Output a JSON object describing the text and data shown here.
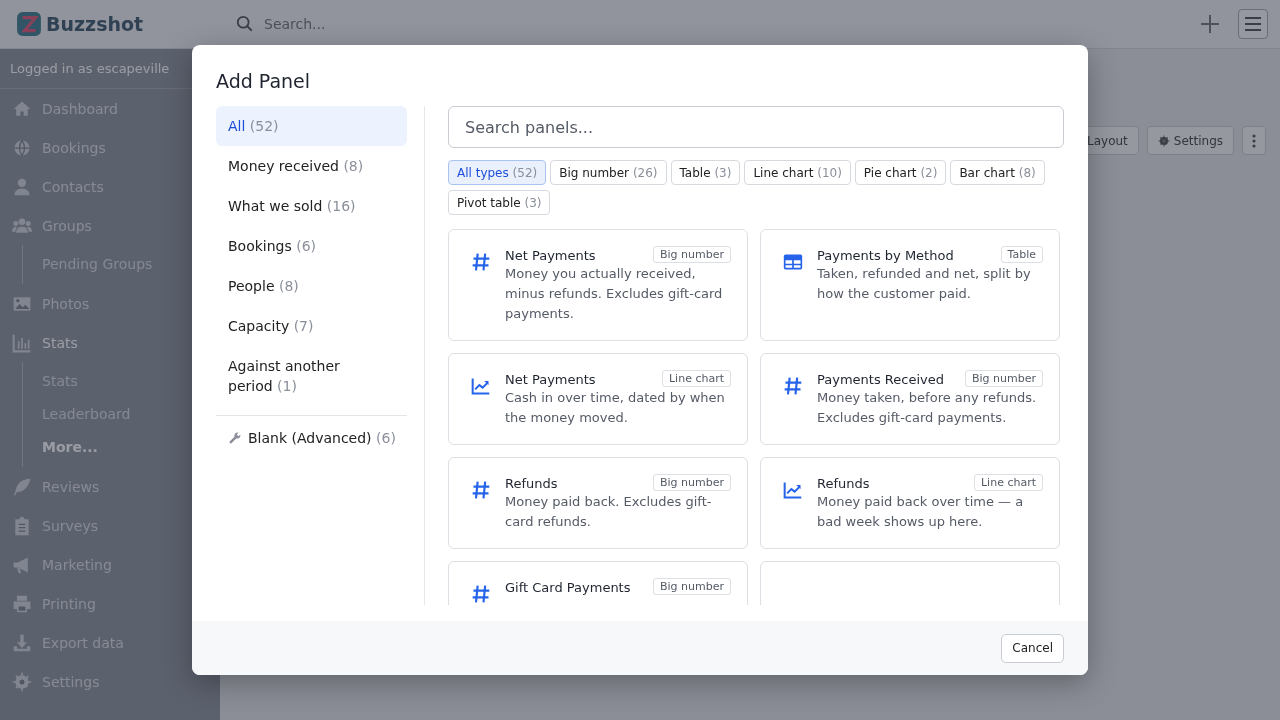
{
  "app": {
    "logo": "Buzzshot",
    "search": {
      "placeholder": "Search..."
    },
    "user": "Logged in as escapeville",
    "nav": [
      {
        "label": "Dashboard",
        "selected": false
      },
      {
        "label": "Bookings",
        "selected": false
      },
      {
        "label": "Contacts",
        "selected": false
      },
      {
        "label": "Groups",
        "selected": false,
        "children": [
          {
            "label": "Pending Groups",
            "selected": false
          }
        ]
      },
      {
        "label": "Photos",
        "selected": false
      },
      {
        "label": "Stats",
        "selected": true,
        "children": [
          {
            "label": "Stats",
            "selected": false
          },
          {
            "label": "Leaderboard",
            "selected": false
          },
          {
            "label": "More...",
            "selected": true
          }
        ]
      },
      {
        "label": "Reviews",
        "selected": false
      },
      {
        "label": "Surveys",
        "selected": false
      },
      {
        "label": "Marketing",
        "selected": false
      },
      {
        "label": "Printing",
        "selected": false
      },
      {
        "label": "Export data",
        "selected": false
      },
      {
        "label": "Settings",
        "selected": false
      }
    ],
    "toolbar": [
      "Layout",
      "Settings"
    ]
  },
  "dialog": {
    "title": "Add Panel",
    "categories": [
      {
        "label": "All",
        "count": "(52)",
        "selected": true
      },
      {
        "label": "Money received",
        "count": "(8)",
        "selected": false
      },
      {
        "label": "What we sold",
        "count": "(16)",
        "selected": false
      },
      {
        "label": "Bookings",
        "count": "(6)",
        "selected": false
      },
      {
        "label": "People",
        "count": "(8)",
        "selected": false
      },
      {
        "label": "Capacity",
        "count": "(7)",
        "selected": false
      },
      {
        "label": "Against another period",
        "count": "(1)",
        "selected": false
      }
    ],
    "advanced": {
      "label": "Blank (Advanced)",
      "count": "(6)",
      "selected": false
    },
    "search": {
      "placeholder": "Search panels..."
    },
    "types": [
      {
        "label": "All types",
        "count": "(52)",
        "selected": true
      },
      {
        "label": "Big number",
        "count": "(26)",
        "selected": false
      },
      {
        "label": "Table",
        "count": "(3)",
        "selected": false
      },
      {
        "label": "Line chart",
        "count": "(10)",
        "selected": false
      },
      {
        "label": "Pie chart",
        "count": "(2)",
        "selected": false
      },
      {
        "label": "Bar chart",
        "count": "(8)",
        "selected": false
      },
      {
        "label": "Pivot table",
        "count": "(3)",
        "selected": false
      }
    ],
    "panels": [
      {
        "kind": "big_number",
        "title": "Net Payments",
        "tag": "Big number",
        "description": "Money you actually received, minus refunds. Excludes gift-card payments."
      },
      {
        "kind": "table",
        "title": "Payments by Method",
        "tag": "Table",
        "description": "Taken, refunded and net, split by how the customer paid."
      },
      {
        "kind": "line_chart",
        "title": "Net Payments",
        "tag": "Line chart",
        "description": "Cash in over time, dated by when the money moved."
      },
      {
        "kind": "big_number",
        "title": "Payments Received",
        "tag": "Big number",
        "description": "Money taken, before any refunds. Excludes gift-card payments."
      },
      {
        "kind": "big_number",
        "title": "Refunds",
        "tag": "Big number",
        "description": "Money paid back. Excludes gift-card refunds."
      },
      {
        "kind": "line_chart",
        "title": "Refunds",
        "tag": "Line chart",
        "description": "Money paid back over time — a bad week shows up here."
      },
      {
        "kind": "big_number",
        "title": "Gift Card Payments",
        "tag": "Big number"
      },
      {
        "kind": "hidden"
      }
    ],
    "buttons": [
      "Cancel"
    ]
  }
}
